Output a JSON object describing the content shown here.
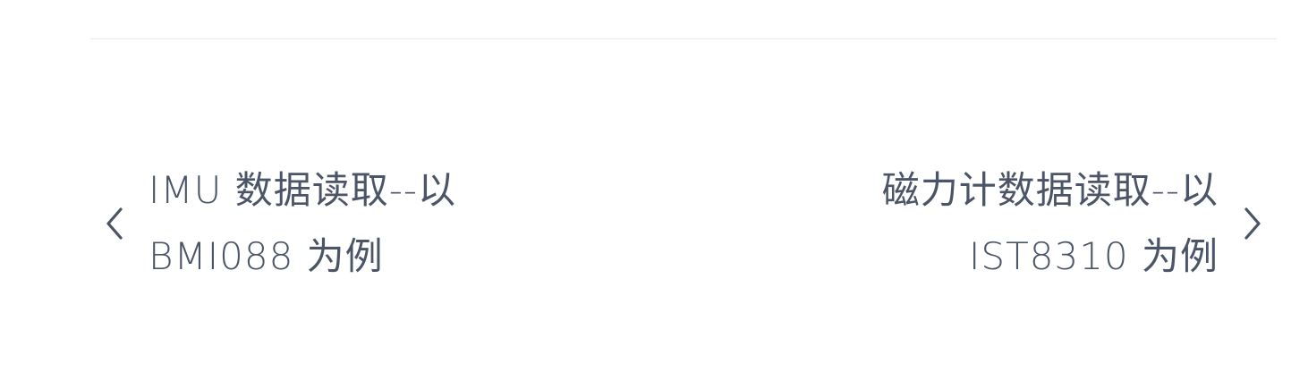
{
  "pagination": {
    "prev": {
      "line1": "IMU 数据读取--以",
      "line2": "BMI088 为例",
      "icon": "chevron-left-icon"
    },
    "next": {
      "line1": "磁力计数据读取--以",
      "line2": "IST8310 为例",
      "icon": "chevron-right-icon"
    }
  },
  "colors": {
    "text": "#4b5567",
    "divider": "#e9ebef",
    "background": "#ffffff"
  }
}
